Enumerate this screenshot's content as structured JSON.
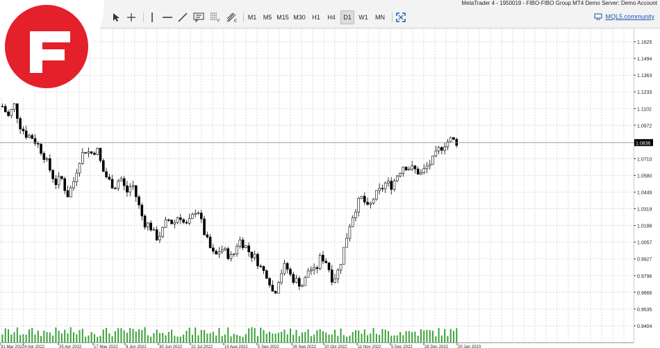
{
  "window": {
    "title": "MetaTrader 4 - 1950019 - FIBO-FIBO Group MT4 Demo Server: Demo Account"
  },
  "toolbar": {
    "timeframes": [
      "M1",
      "M5",
      "M15",
      "M30",
      "H1",
      "H4",
      "D1",
      "W1",
      "MN"
    ],
    "active_timeframe": "D1",
    "community_link": "MQL5.community"
  },
  "colors": {
    "candle": "#000000",
    "volume": "#3aa13a",
    "grid": "#c9c9c9",
    "logo_red": "#e4202a",
    "link": "#1a56b0"
  },
  "icons": [
    "cursor-icon",
    "crosshair-icon",
    "vertical-line-icon",
    "horizontal-line-icon",
    "trendline-icon",
    "text-label-icon",
    "fibonacci-icon",
    "andrews-pitchfork-icon",
    "fullscreen-icon",
    "community-icon"
  ],
  "chart_data": {
    "type": "candlestick",
    "current_price": "1.0836",
    "price_ticks": [
      "1.1625",
      "1.1494",
      "1.1363",
      "1.1233",
      "1.1102",
      "1.0972",
      "1.0836",
      "1.0710",
      "1.0580",
      "1.0449",
      "1.0319",
      "1.0188",
      "1.0057",
      "0.9927",
      "0.9796",
      "0.9666",
      "0.9535",
      "0.9404"
    ],
    "date_labels": [
      "31 Mar 2022",
      "4 Apr 2022",
      "25 Apr 2022",
      "17 May 2022",
      "9 Jun 2022",
      "30 Jun 2022",
      "22 Jul 2022",
      "15 Aug 2022",
      "5 Sep 2022",
      "26 Sep 2022",
      "20 Oct 2022",
      "11 Nov 2022",
      "5 Dec 2022",
      "28 Dec 2022",
      "20 Jan 2023"
    ],
    "close_path": [
      1.112,
      1.104,
      1.113,
      1.097,
      1.09,
      1.088,
      1.082,
      1.074,
      1.063,
      1.052,
      1.056,
      1.042,
      1.052,
      1.07,
      1.078,
      1.075,
      1.079,
      1.062,
      1.054,
      1.049,
      1.057,
      1.044,
      1.052,
      1.036,
      1.021,
      1.019,
      1.009,
      1.013,
      1.024,
      1.02,
      1.028,
      1.018,
      1.023,
      1.034,
      1.016,
      1.003,
      0.994,
      1.001,
      0.997,
      0.993,
      1.008,
      1.004,
      0.997,
      0.993,
      0.984,
      0.98,
      0.964,
      0.98,
      0.988,
      0.978,
      0.975,
      0.972,
      0.986,
      0.982,
      0.995,
      0.99,
      0.976,
      0.984,
      1.003,
      1.022,
      1.034,
      1.041,
      1.031,
      1.041,
      1.046,
      1.052,
      1.05,
      1.059,
      1.066,
      1.064,
      1.062,
      1.059,
      1.065,
      1.07,
      1.078,
      1.083,
      1.086,
      1.084
    ],
    "volume_note": ""
  }
}
